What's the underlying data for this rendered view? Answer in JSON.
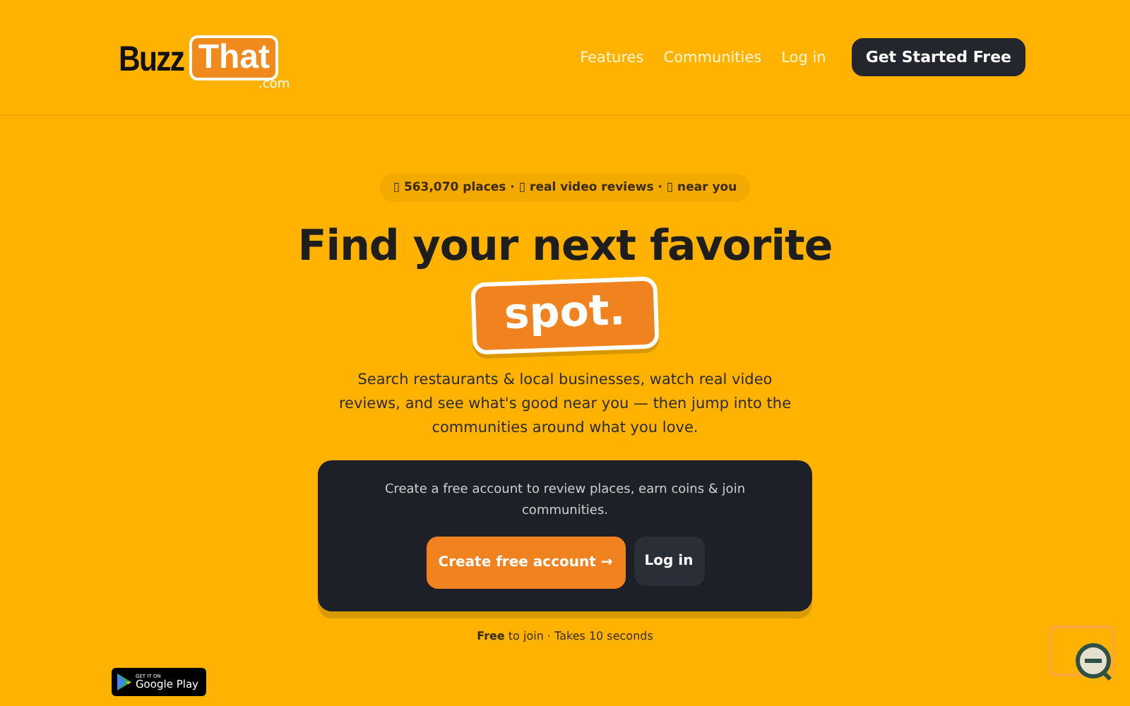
{
  "logo": {
    "part_1": "Buzz",
    "part_2": "That",
    "suffix": ".com"
  },
  "nav": {
    "links": [
      "Features",
      "Communities",
      "Log in"
    ],
    "cta": "Get Started Free"
  },
  "hero": {
    "badge": "▯ 563,070 places · ▯ real video reviews · ▯ near you",
    "title": "Find your next favorite",
    "highlight": "spot.",
    "subtitle": "Search restaurants & local businesses, watch real video reviews, and see what's good near you — then jump into the communities around what you love."
  },
  "signup": {
    "text": "Create a free account to review places, earn coins & join communities.",
    "primary": "Create free account →",
    "secondary": "Log in"
  },
  "note": "**Free** to join · Takes 10 seconds",
  "store_badge": {
    "small": "GET IT ON",
    "name": "Google Play"
  }
}
